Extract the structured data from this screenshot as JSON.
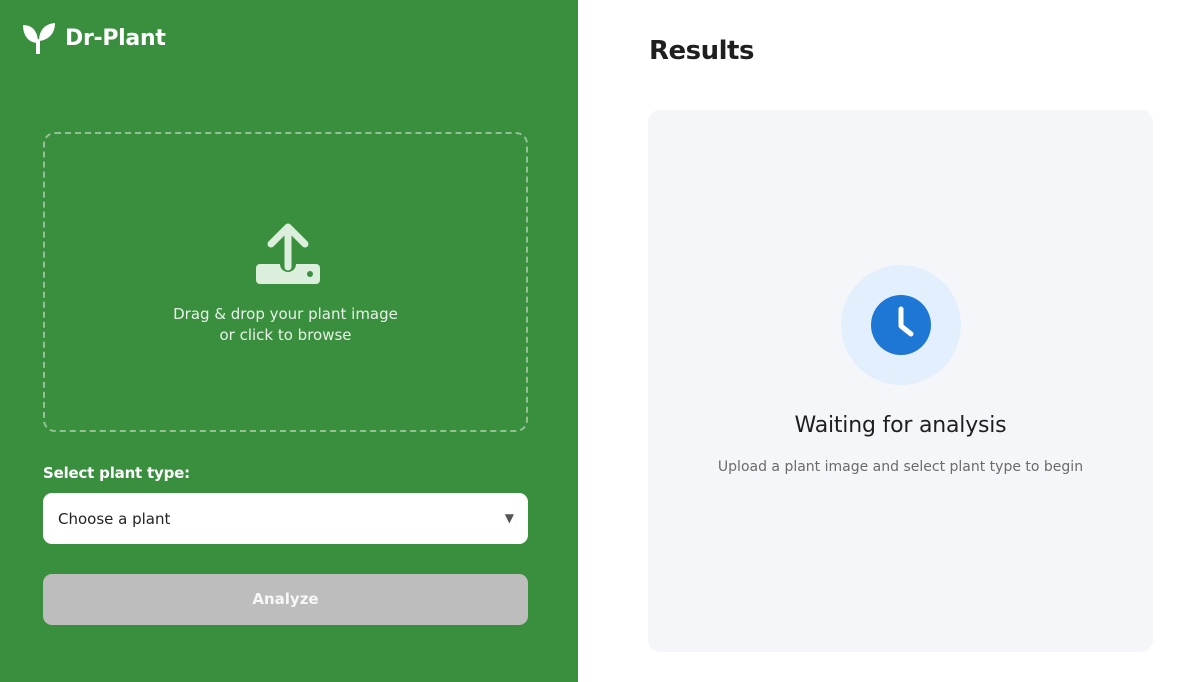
{
  "brand": {
    "name": "Dr-Plant",
    "logo_icon": "sprout-icon",
    "color": "#3a8f3e"
  },
  "upload": {
    "icon": "upload-icon",
    "line1": "Drag & drop your plant image",
    "line2": "or click to browse"
  },
  "plant_select": {
    "label": "Select plant type:",
    "value": "Choose a plant",
    "caret": "▼"
  },
  "analyze_button": {
    "label": "Analyze",
    "disabled": true
  },
  "results": {
    "title": "Results",
    "status_icon": "clock-icon",
    "accent": "#1e77d4",
    "waiting_title": "Waiting for analysis",
    "waiting_subtitle": "Upload a plant image and select plant type to begin"
  }
}
